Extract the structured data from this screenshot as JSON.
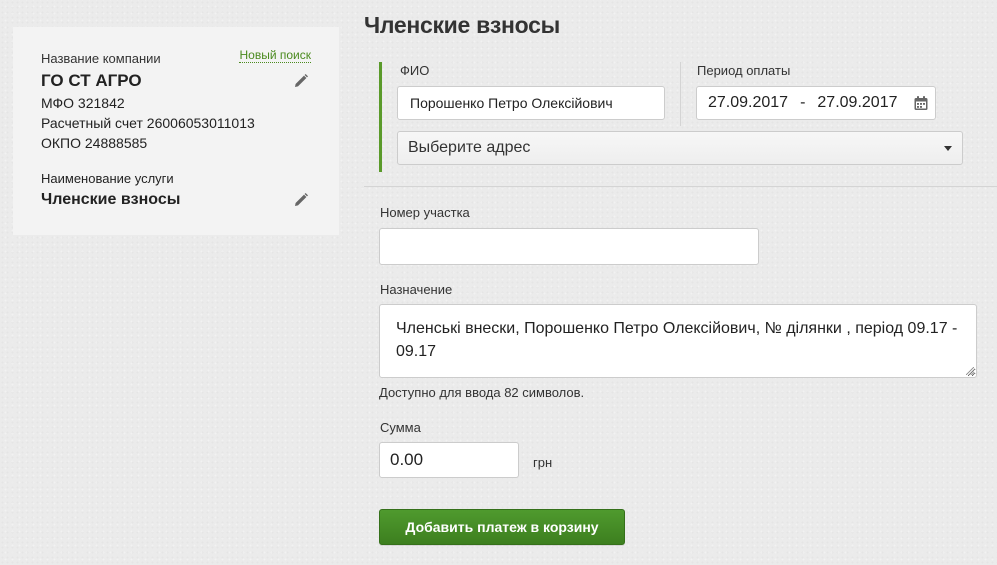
{
  "company_card": {
    "company_label": "Название компании",
    "new_search_link": "Новый поиск",
    "company_name": "ГО СТ АГРО",
    "mfo": "МФО 321842",
    "account": "Расчетный счет 26006053011013",
    "okpo": "ОКПО 24888585",
    "service_label": "Наименование услуги",
    "service_name": "Членские взносы"
  },
  "page_title": "Членские взносы",
  "form": {
    "fio_label": "ФИО",
    "fio_value": "Порошенко Петро Олексійович",
    "period_label": "Период оплаты",
    "period_from": "27.09.2017",
    "period_separator": "-",
    "period_to": "27.09.2017",
    "address_placeholder": "Выберите адрес",
    "plot_label": "Номер участка",
    "plot_value": "",
    "purpose_label": "Назначение",
    "purpose_value": "Членські внески, Порошенко Петро Олексійович, № ділянки , період 09.17 - 09.17",
    "chars_hint": "Доступно для ввода 82 символов.",
    "sum_label": "Сумма",
    "sum_value": "0.00",
    "currency": "грн",
    "add_button": "Добавить платеж в корзину"
  },
  "colors": {
    "accent_green": "#4a8a1e",
    "button_green": "#4f9a2e"
  },
  "icons": {
    "edit": "pencil-icon",
    "calendar": "calendar-icon",
    "dropdown": "chevron-down-icon"
  }
}
